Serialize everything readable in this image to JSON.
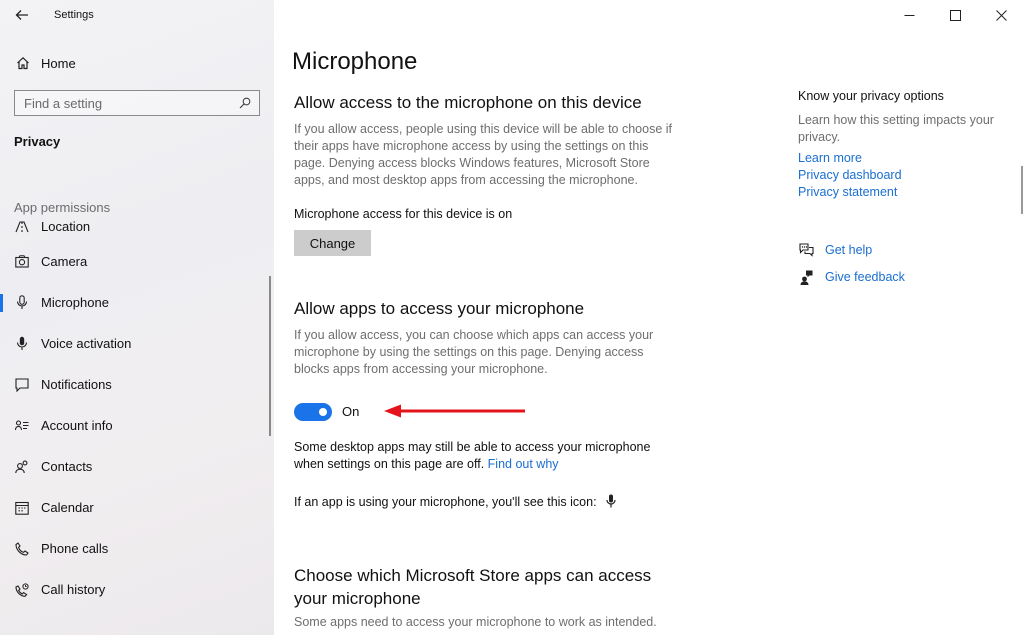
{
  "window": {
    "title": "Settings",
    "accent": "#1a73e8",
    "link_color": "#1a6fd1",
    "controls": [
      "minimize-icon",
      "maximize-icon",
      "close-icon"
    ]
  },
  "sidebar": {
    "home_label": "Home",
    "search_placeholder": "Find a setting",
    "section_title": "Privacy",
    "group_title": "App permissions",
    "items": [
      {
        "label": "Location",
        "icon": "location-icon"
      },
      {
        "label": "Camera",
        "icon": "camera-icon"
      },
      {
        "label": "Microphone",
        "icon": "microphone-icon",
        "selected": true
      },
      {
        "label": "Voice activation",
        "icon": "voice-activation-icon"
      },
      {
        "label": "Notifications",
        "icon": "notifications-icon"
      },
      {
        "label": "Account info",
        "icon": "account-info-icon"
      },
      {
        "label": "Contacts",
        "icon": "contacts-icon"
      },
      {
        "label": "Calendar",
        "icon": "calendar-icon"
      },
      {
        "label": "Phone calls",
        "icon": "phone-icon"
      },
      {
        "label": "Call history",
        "icon": "call-history-icon"
      }
    ]
  },
  "main": {
    "page_title": "Microphone",
    "device_section": {
      "heading": "Allow access to the microphone on this device",
      "description": "If you allow access, people using this device will be able to choose if their apps have microphone access by using the settings on this page. Denying access blocks Windows features, Microsoft Store apps, and most desktop apps from accessing the microphone.",
      "status": "Microphone access for this device is on",
      "button": "Change"
    },
    "apps_section": {
      "heading": "Allow apps to access your microphone",
      "description": "If you allow access, you can choose which apps can access your microphone by using the settings on this page. Denying access blocks apps from accessing your microphone.",
      "toggle_state": "On",
      "toggle_on": true,
      "annotation_color": "#e3141b",
      "note": "Some desktop apps may still be able to access your microphone when settings on this page are off.",
      "note_link": "Find out why",
      "icon_note": "If an app is using your microphone, you'll see this icon:"
    },
    "store_section": {
      "heading_line1": "Choose which Microsoft Store apps can access",
      "heading_line2": "your microphone",
      "description": "Some apps need to access your microphone to work as intended."
    }
  },
  "aside": {
    "title": "Know your privacy options",
    "description": "Learn how this setting impacts your privacy.",
    "links": [
      "Learn more",
      "Privacy dashboard",
      "Privacy statement"
    ],
    "get_help": "Get help",
    "give_feedback": "Give feedback"
  }
}
